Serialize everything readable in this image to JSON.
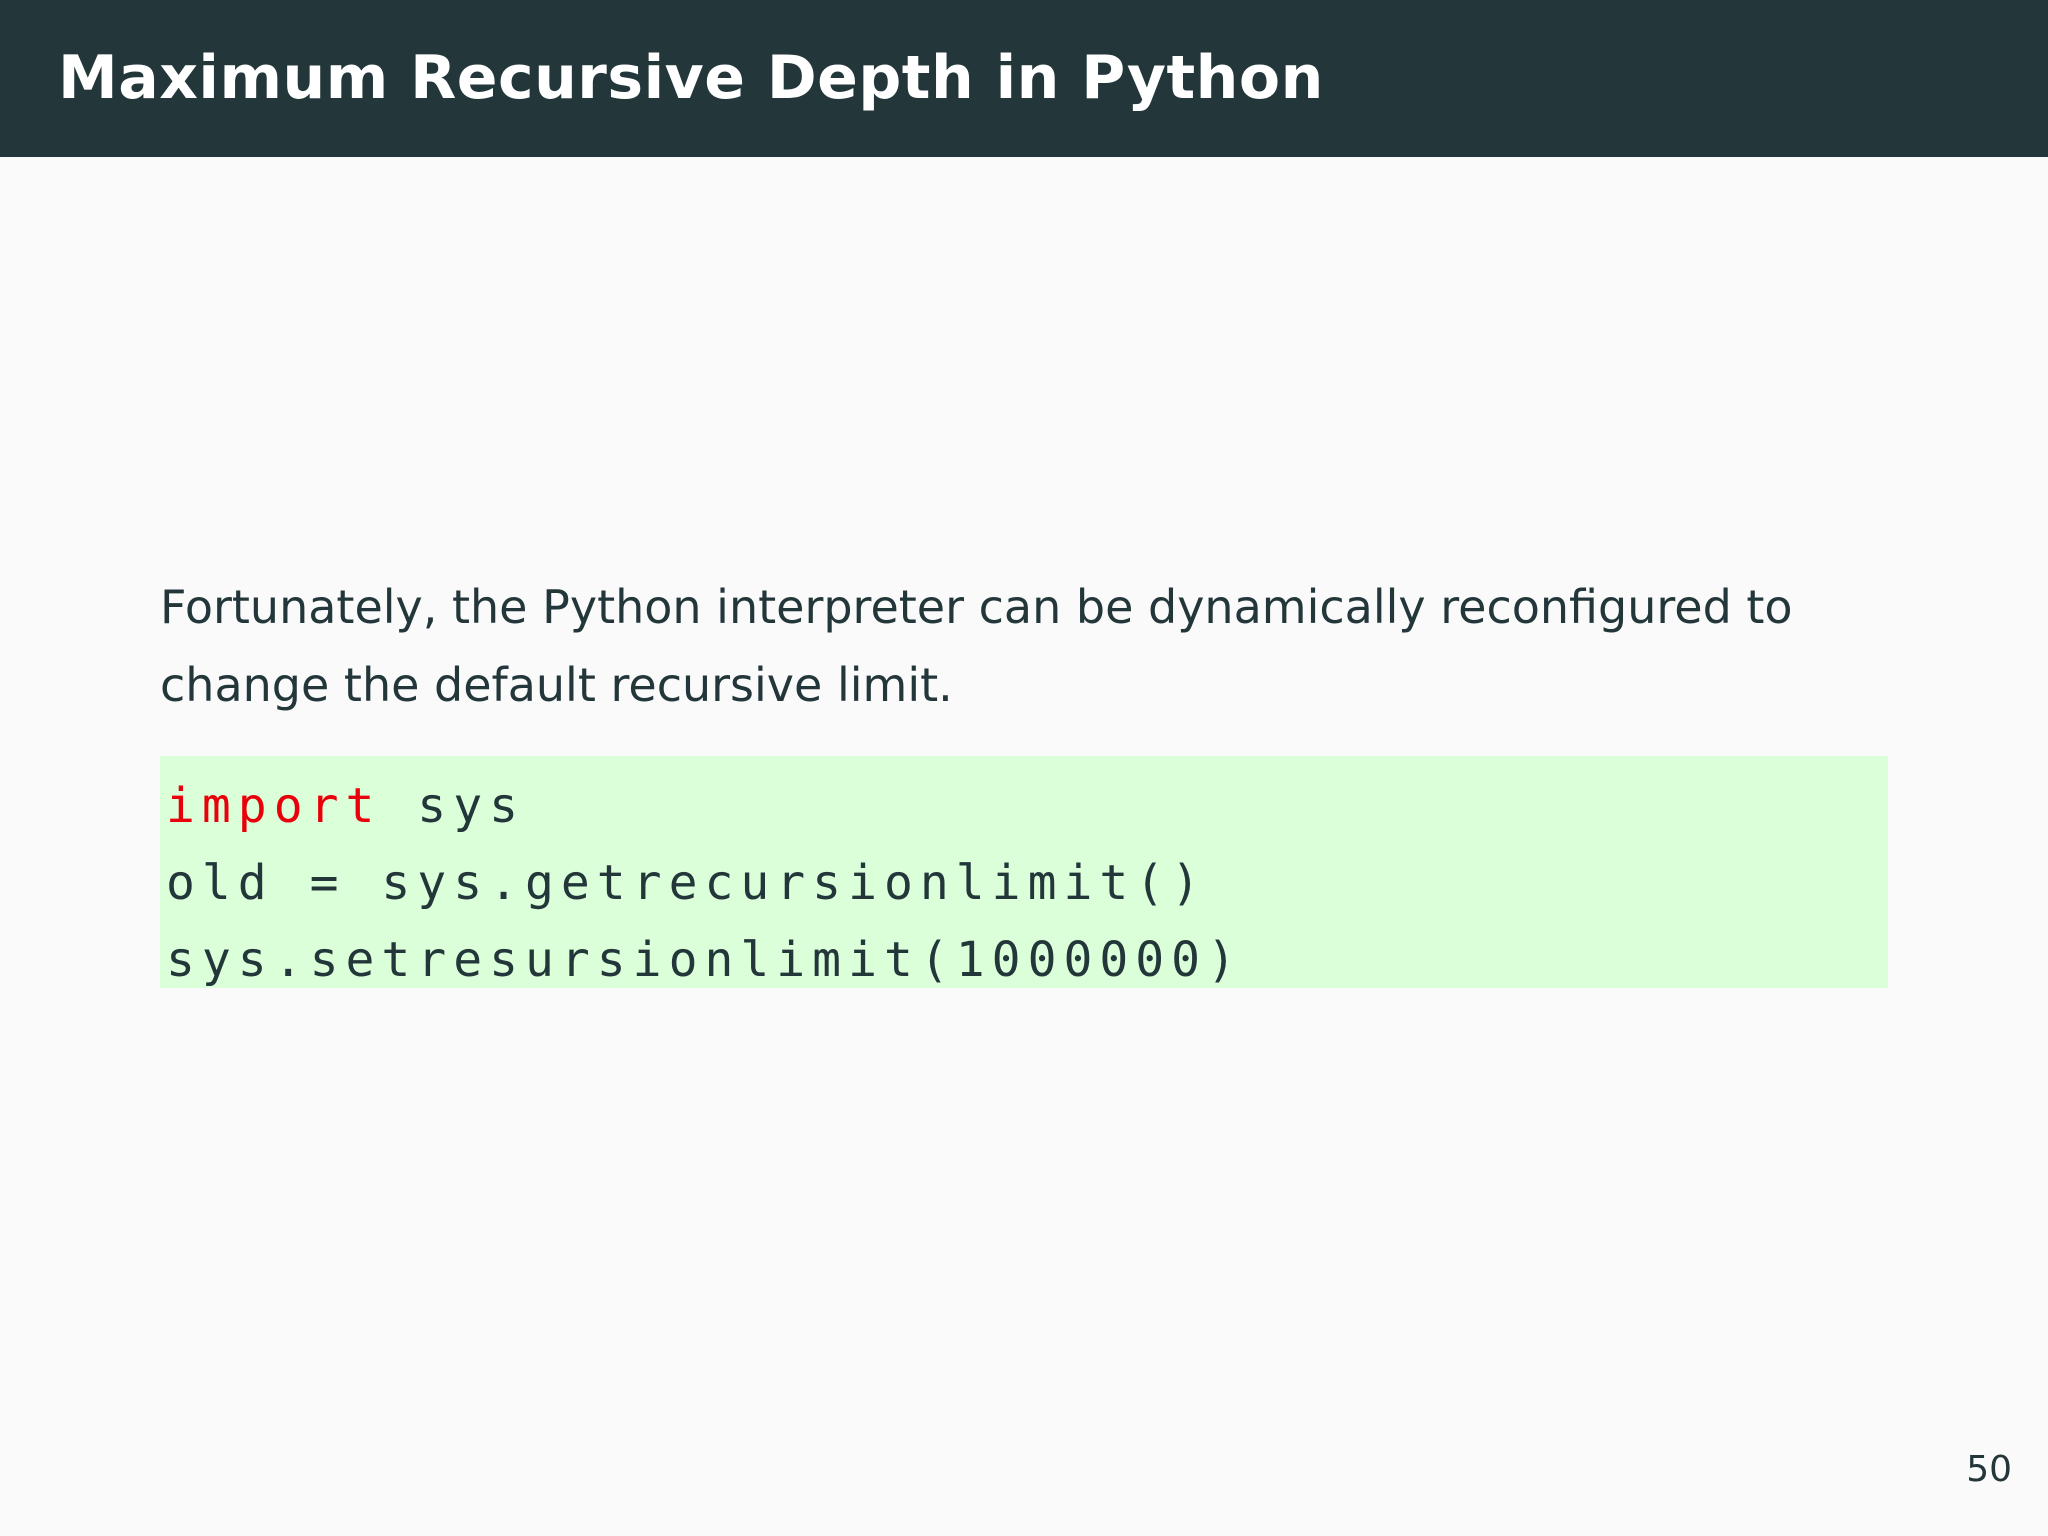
{
  "slide": {
    "title": "Maximum Recursive Depth in Python",
    "body_text": "Fortunately, the Python interpreter can be dynamically reconfigured to change the default recursive limit.",
    "page_number": "50"
  },
  "code": {
    "line1": {
      "keyword": "import",
      "rest": " sys"
    },
    "line2": "old = sys.getrecursionlimit()",
    "line3": "sys.setresursionlimit(1000000)"
  },
  "colors": {
    "title_bar": "#23373b",
    "code_background": "#dbffd9",
    "keyword": "#e8000b",
    "text": "#23373b"
  }
}
